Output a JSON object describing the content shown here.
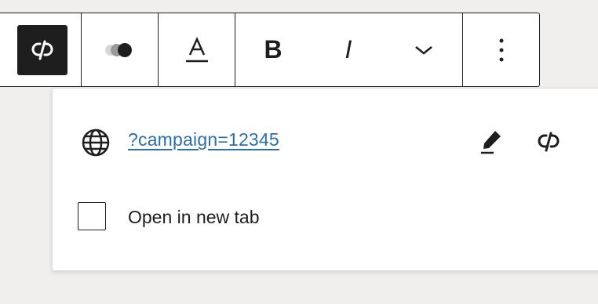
{
  "colors": {
    "page_bg": "#f0efee",
    "link_color": "#2b6ea8",
    "active_button_bg": "#1e1e1e"
  },
  "toolbar": {
    "buttons": [
      {
        "icon": "unlink-icon",
        "active": true
      },
      {
        "icon": "highlight-icon"
      },
      {
        "icon": "text-color-icon"
      },
      {
        "icon": "bold-icon",
        "glyph": "B"
      },
      {
        "icon": "italic-icon",
        "glyph": "I"
      },
      {
        "icon": "chevron-down-icon"
      },
      {
        "icon": "more-options-icon"
      }
    ]
  },
  "link_popover": {
    "url_text": "?campaign=12345",
    "open_new_tab_label": "Open in new tab",
    "open_new_tab_checked": false,
    "icons": {
      "globe": "globe-icon",
      "edit": "pencil-icon",
      "unlink": "unlink-icon"
    }
  }
}
